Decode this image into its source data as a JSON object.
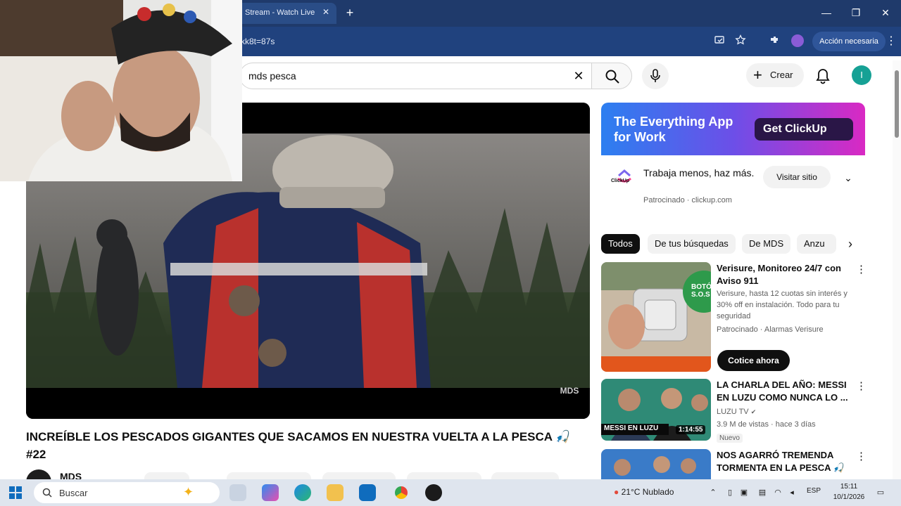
{
  "browser": {
    "tab_title": "Stream - Watch Live",
    "tab_close": "✕",
    "new_tab": "+",
    "address_fragment": "kk8t=87s",
    "action_button": "Acción necesaria",
    "window_controls": [
      "—",
      "❐",
      "✕"
    ]
  },
  "youtube": {
    "search_query": "mds pesca",
    "create_label": "Crear",
    "avatar_letter": "I",
    "video": {
      "title": "INCREÍBLE LOS PESCADOS GIGANTES QUE SACAMOS EN NUESTRA VUELTA A LA PESCA 🎣 #22",
      "channel": "MDS",
      "watermark": "MDS"
    },
    "ad": {
      "headline": "The Everything App for Work",
      "cta": "Get ClickUp",
      "logo_text": "ClickUp",
      "text": "Trabaja menos, haz más.",
      "sponsor": "Patrocinado · clickup.com",
      "visit_label": "Visitar sitio"
    },
    "chips": [
      "Todos",
      "De tus búsquedas",
      "De MDS",
      "Anzu"
    ],
    "recommendations": [
      {
        "title": "Verisure, Monitoreo 24/7 con Aviso 911",
        "desc": "Verisure, hasta 12 cuotas sin interés y 30% off en instalación. Todo para tu seguridad",
        "meta": "Patrocinado · Alarmas Verisure",
        "cta": "Cotice ahora",
        "thumb_caption": "BOTÓN S.O.S"
      },
      {
        "title": "LA CHARLA DEL AÑO: MESSI EN LUZU COMO NUNCA LO ...",
        "channel": "LUZU TV",
        "meta": "3.9 M de vistas · hace 3 días",
        "badge": "Nuevo",
        "thumb_caption": "MESSI EN LUZU",
        "duration": "1:14:55"
      },
      {
        "title": "NOS AGARRÓ TREMENDA TORMENTA EN LA PESCA 🎣 ..."
      }
    ]
  },
  "taskbar": {
    "search_placeholder": "Buscar",
    "weather": "21°C  Nublado",
    "language": "ESP",
    "time": "15:11",
    "date": "10/1/2026"
  },
  "colors": {
    "tabbar": "#1f3a6b",
    "addressbar": "#20427e",
    "yt_avatar": "#16a195",
    "ad_gradient_start": "#2c7ff0",
    "ad_gradient_end": "#d929c3"
  }
}
